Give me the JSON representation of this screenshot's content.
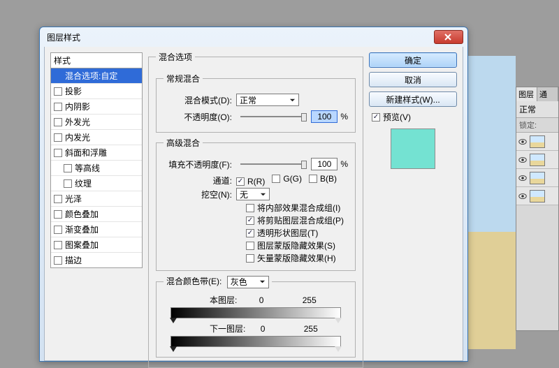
{
  "dialog": {
    "title": "图层样式",
    "styles_header": "样式",
    "styles": [
      {
        "label": "混合选项:自定",
        "checkbox": false,
        "selected": true
      },
      {
        "label": "投影",
        "checkbox": true
      },
      {
        "label": "内阴影",
        "checkbox": true
      },
      {
        "label": "外发光",
        "checkbox": true
      },
      {
        "label": "内发光",
        "checkbox": true
      },
      {
        "label": "斜面和浮雕",
        "checkbox": true
      },
      {
        "label": "等高线",
        "checkbox": true,
        "indent": true
      },
      {
        "label": "纹理",
        "checkbox": true,
        "indent": true
      },
      {
        "label": "光泽",
        "checkbox": true
      },
      {
        "label": "颜色叠加",
        "checkbox": true
      },
      {
        "label": "渐变叠加",
        "checkbox": true
      },
      {
        "label": "图案叠加",
        "checkbox": true
      },
      {
        "label": "描边",
        "checkbox": true
      }
    ],
    "blend_options": {
      "group": "混合选项",
      "general": {
        "legend": "常规混合",
        "mode_label": "混合模式(D):",
        "mode_value": "正常",
        "opacity_label": "不透明度(O):",
        "opacity_value": "100",
        "opacity_suffix": "%"
      },
      "advanced": {
        "legend": "高级混合",
        "fill_label": "填充不透明度(F):",
        "fill_value": "100",
        "fill_suffix": "%",
        "channels_label": "通道:",
        "channels": [
          {
            "label": "R(R)",
            "on": true
          },
          {
            "label": "G(G)",
            "on": false
          },
          {
            "label": "B(B)",
            "on": false
          }
        ],
        "knockout_label": "挖空(N):",
        "knockout_value": "无",
        "opts": [
          {
            "label": "将内部效果混合成组(I)",
            "on": false
          },
          {
            "label": "将剪贴图层混合成组(P)",
            "on": true
          },
          {
            "label": "透明形状图层(T)",
            "on": true
          },
          {
            "label": "图层蒙版隐藏效果(S)",
            "on": false
          },
          {
            "label": "矢量蒙版隐藏效果(H)",
            "on": false
          }
        ]
      },
      "blendif": {
        "legend": "混合颜色带(E):",
        "select": "灰色",
        "this_label": "本图层:",
        "this_low": "0",
        "this_high": "255",
        "under_label": "下一图层:",
        "under_low": "0",
        "under_high": "255"
      }
    },
    "buttons": {
      "ok": "确定",
      "cancel": "取消",
      "new_style": "新建样式(W)...",
      "preview": "预览(V)"
    },
    "swatch_color": "#74e2d2"
  },
  "layers_panel": {
    "tab1": "图层",
    "tab2": "通",
    "mode": "正常",
    "lock": "锁定:"
  }
}
